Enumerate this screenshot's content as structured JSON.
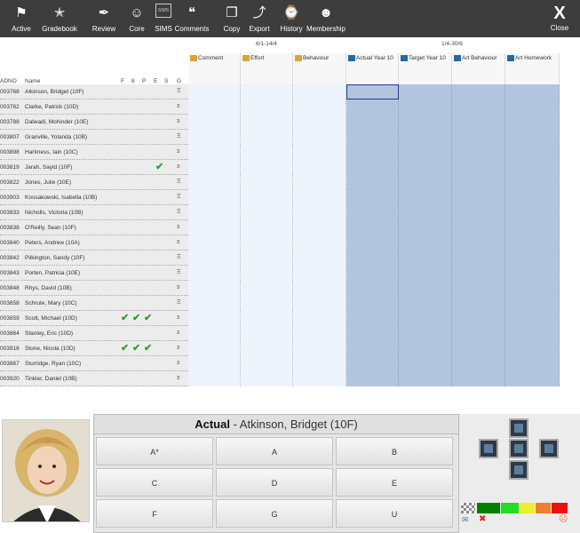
{
  "toolbar": {
    "items": [
      {
        "label": "Active",
        "icon": "flag-icon"
      },
      {
        "label": "Gradebook",
        "icon": "star-icon"
      },
      {
        "label": "Review",
        "icon": "pen-icon"
      },
      {
        "label": "Core",
        "icon": "person-icon"
      },
      {
        "label": "SIMS",
        "icon": "sims-icon",
        "icon_text": "SIMS"
      },
      {
        "label": "Comments",
        "icon": "speech-bubbles-icon"
      },
      {
        "label": "Copy",
        "icon": "copy-icon"
      },
      {
        "label": "Export",
        "icon": "export-icon"
      },
      {
        "label": "History",
        "icon": "history-icon"
      },
      {
        "label": "Membership",
        "icon": "membership-icon"
      }
    ],
    "close_label": "Close",
    "close_icon": "X"
  },
  "grid": {
    "band1_label": "6/1-14/4",
    "band2_label": "1/4-30/6",
    "header_adno": "ADNO",
    "header_name": "Name",
    "flag_headers": [
      "F",
      "8",
      "P",
      "E",
      "S",
      "G"
    ],
    "columns": [
      "Comment",
      "Effort",
      "Behaviour",
      "Actual Year 10",
      "Target Year 10",
      "Art Behaviour",
      "Art Homework"
    ],
    "students": [
      {
        "adno": "003768",
        "name": "Atkinson, Bridget (10F)",
        "ticks": 0,
        "g": "Ξ"
      },
      {
        "adno": "003782",
        "name": "Clarke, Patrick (10D)",
        "ticks": 0,
        "g": "ɜ"
      },
      {
        "adno": "003788",
        "name": "Dalwadi, Mohinder (10E)",
        "ticks": 0,
        "g": "ɜ"
      },
      {
        "adno": "003807",
        "name": "Granville, Yolanda (10B)",
        "ticks": 0,
        "g": "Ξ"
      },
      {
        "adno": "003898",
        "name": "Harkness, Iain (10C)",
        "ticks": 0,
        "g": "ɜ"
      },
      {
        "adno": "003819",
        "name": "Jarah, Sayid (10F)",
        "ticks": 1,
        "g": "ɜ"
      },
      {
        "adno": "003822",
        "name": "Jones, Julie (10E)",
        "ticks": 0,
        "g": "Ξ"
      },
      {
        "adno": "003903",
        "name": "Kossakowski, Isabella (10B)",
        "ticks": 0,
        "g": "Ξ"
      },
      {
        "adno": "003833",
        "name": "Nicholls, Victoria (10B)",
        "ticks": 0,
        "g": "Ξ"
      },
      {
        "adno": "003838",
        "name": "O'Reilly, Sean (10F)",
        "ticks": 0,
        "g": "ɜ"
      },
      {
        "adno": "003840",
        "name": "Peters, Andrew (10A)",
        "ticks": 0,
        "g": "ɜ"
      },
      {
        "adno": "003842",
        "name": "Pilkington, Sandy (10F)",
        "ticks": 0,
        "g": "Ξ"
      },
      {
        "adno": "003843",
        "name": "Porten, Patricia (10E)",
        "ticks": 0,
        "g": "Ξ"
      },
      {
        "adno": "003848",
        "name": "Rhys, David (10B)",
        "ticks": 0,
        "g": "ɜ"
      },
      {
        "adno": "003858",
        "name": "Schrute, Mary (10C)",
        "ticks": 0,
        "g": "Ξ"
      },
      {
        "adno": "003859",
        "name": "Scott, Michael (10D)",
        "ticks": 3,
        "g": "ɜ"
      },
      {
        "adno": "003864",
        "name": "Stanley, Eric (10D)",
        "ticks": 0,
        "g": "ɜ"
      },
      {
        "adno": "003916",
        "name": "Stone, Nicola (10D)",
        "ticks": 3,
        "g": "ɜ"
      },
      {
        "adno": "003867",
        "name": "Sturridge, Ryan (10C)",
        "ticks": 0,
        "g": "ɜ"
      },
      {
        "adno": "003920",
        "name": "Tinkler, Daniel (10B)",
        "ticks": 0,
        "g": "ɜ"
      }
    ]
  },
  "entry": {
    "field": "Actual",
    "student": " - Atkinson, Bridget (10F)",
    "grades": [
      "A*",
      "A",
      "B",
      "C",
      "D",
      "E",
      "F",
      "G",
      "U"
    ]
  },
  "nav": {
    "swatch_colors": [
      "#008000",
      "#22dd22",
      "#eeee33",
      "#f08030",
      "#ee1111"
    ]
  }
}
